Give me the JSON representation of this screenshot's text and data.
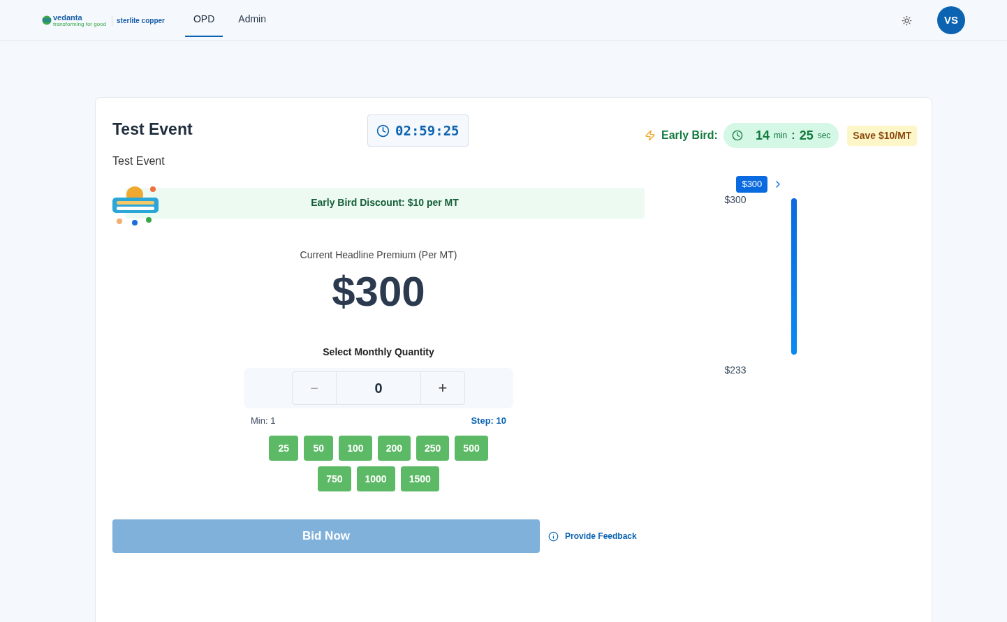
{
  "header": {
    "logo": {
      "brand": "vedanta",
      "tagline": "transforming for good",
      "partner": "sterlite copper"
    },
    "nav": [
      {
        "label": "OPD",
        "selected": true
      },
      {
        "label": "Admin",
        "selected": false
      }
    ],
    "avatar": "VS"
  },
  "event": {
    "title": "Test Event",
    "subtitle": "Test Event",
    "timer": "02:59:25",
    "early_bird": {
      "label": "Early Bird:",
      "minutes": "14",
      "min_unit": "min",
      "separator": ":",
      "seconds": "25",
      "sec_unit": "sec",
      "save": "Save $10/MT"
    },
    "banner": "Early Bird Discount: $10 per MT",
    "premium_label": "Current Headline Premium (Per MT)",
    "premium": "$300",
    "quantity": {
      "label": "Select Monthly Quantity",
      "minus": "−",
      "value": "0",
      "plus": "+",
      "min": "Min: 1",
      "step": "Step: 10"
    },
    "presets": [
      [
        "25",
        "50",
        "100",
        "200",
        "250",
        "500"
      ],
      [
        "750",
        "1000",
        "1500"
      ]
    ],
    "bid": {
      "label": "Bid Now",
      "disabled": true
    },
    "feedback": "Provide Feedback",
    "scale": {
      "tooltip": "$300",
      "top": "$300",
      "bottom": "$233",
      "level": 1
    }
  }
}
